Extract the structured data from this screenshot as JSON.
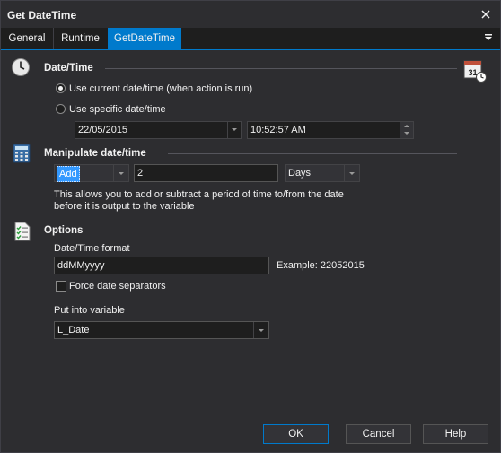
{
  "window": {
    "title": "Get DateTime"
  },
  "tabs": [
    {
      "label": "General"
    },
    {
      "label": "Runtime"
    },
    {
      "label": "GetDateTime"
    }
  ],
  "datetime_section": {
    "title": "Date/Time",
    "option_current": "Use current date/time (when action is run)",
    "option_specific": "Use specific date/time",
    "selected_option": "current",
    "date_value": "22/05/2015",
    "time_value": "10:52:57 AM"
  },
  "manipulate_section": {
    "title": "Manipulate date/time",
    "operation": "Add",
    "amount": "2",
    "unit": "Days",
    "help_line1": "This allows you to add or subtract a period of time to/from the date",
    "help_line2": "before it is output to the variable"
  },
  "options_section": {
    "title": "Options",
    "format_label": "Date/Time format",
    "format_value": "ddMMyyyy",
    "example_text": "Example: 22052015",
    "force_separators_label": "Force date separators",
    "force_separators_checked": false,
    "variable_label": "Put into variable",
    "variable_value": "L_Date"
  },
  "footer": {
    "ok_label": "OK",
    "cancel_label": "Cancel",
    "help_label": "Help"
  },
  "colors": {
    "background": "#2d2d30",
    "accent": "#007acc",
    "input_background": "#1e1e1e",
    "text": "#f1f1f1"
  },
  "icons": [
    "close-icon",
    "tab-menu-icon",
    "clock-icon",
    "calendar-clock-icon",
    "calculator-icon",
    "checklist-icon",
    "dropdown-arrow-icon",
    "spinner-up-icon",
    "spinner-down-icon"
  ]
}
